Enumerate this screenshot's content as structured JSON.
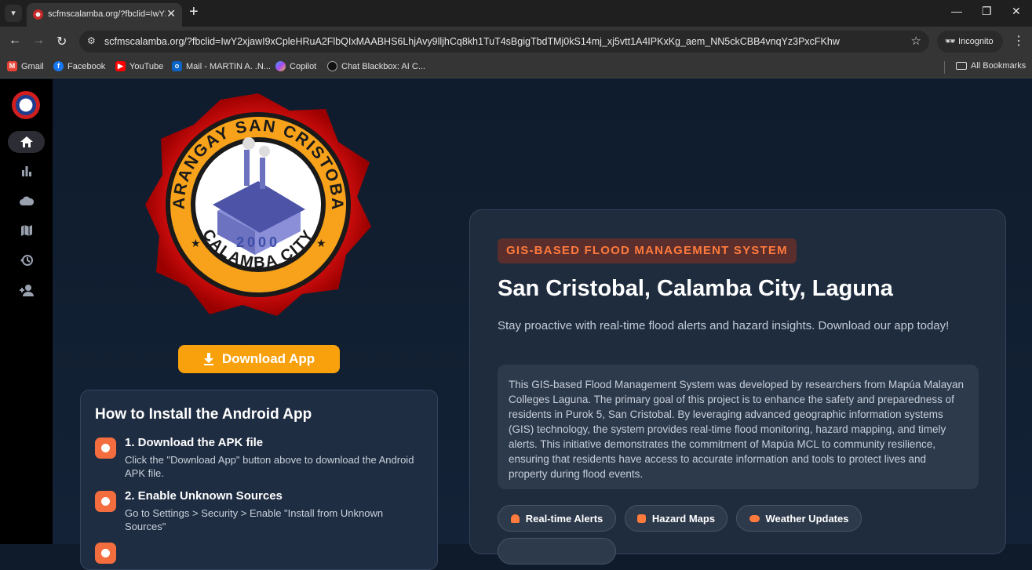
{
  "browser": {
    "tab_title": "scfmscalamba.org/?fbclid=IwY2",
    "url": "scfmscalamba.org/?fbclid=IwY2xjawI9xCpleHRuA2FlbQIxMAABHS6LhjAvy9lljhCq8kh1TuT4sBgigTbdTMj0kS14mj_xj5vtt1A4IPKxKg_aem_NN5ckCBB4vnqYz3PxcFKhw",
    "incognito_label": "Incognito",
    "bookmarks": [
      {
        "label": "Gmail",
        "icon": "gmail-icon",
        "color": "#ea4335"
      },
      {
        "label": "Facebook",
        "icon": "facebook-icon",
        "color": "#1877f2"
      },
      {
        "label": "YouTube",
        "icon": "youtube-icon",
        "color": "#ff0000"
      },
      {
        "label": "Mail - MARTIN A. .N...",
        "icon": "outlook-icon",
        "color": "#0a64c8"
      },
      {
        "label": "Copilot",
        "icon": "copilot-icon",
        "color": "#8a5cf0"
      },
      {
        "label": "Chat Blackbox: AI C...",
        "icon": "blackbox-icon",
        "color": "#222222"
      }
    ],
    "all_bookmarks_label": "All Bookmarks"
  },
  "sidebar": {
    "items": [
      {
        "name": "home",
        "icon": "home-icon",
        "active": true
      },
      {
        "name": "stats",
        "icon": "bar-chart-icon"
      },
      {
        "name": "weather",
        "icon": "cloud-icon"
      },
      {
        "name": "map",
        "icon": "map-icon"
      },
      {
        "name": "history",
        "icon": "history-icon"
      },
      {
        "name": "add-user",
        "icon": "person-add-icon"
      }
    ]
  },
  "logo": {
    "top_text": "BARANGAY SAN CRISTOBAL",
    "bottom_text": "CALAMBA CITY",
    "year": "2000"
  },
  "download_button": "Download App",
  "install": {
    "title": "How to Install the Android App",
    "steps": [
      {
        "title": "1. Download the APK file",
        "desc": "Click the \"Download App\" button above to download the Android APK file."
      },
      {
        "title": "2. Enable Unknown Sources",
        "desc": "Go to Settings > Security > Enable \"Install from Unknown Sources\""
      }
    ]
  },
  "hero": {
    "tag": "GIS-BASED FLOOD MANAGEMENT SYSTEM",
    "headline": "San Cristobal, Calamba City, Laguna",
    "subtitle": "Stay proactive with real-time flood alerts and hazard insights. Download our app today!",
    "about": "This GIS-based Flood Management System was developed by researchers from Mapúa Malayan Colleges Laguna. The primary goal of this project is to enhance the safety and preparedness of residents in Purok 5, San Cristobal. By leveraging advanced geographic information systems (GIS) technology, the system provides real-time flood monitoring, hazard mapping, and timely alerts. This initiative demonstrates the commitment of Mapúa MCL to community resilience, ensuring that residents have access to accurate information and tools to protect lives and property during flood events.",
    "features": [
      "Real-time Alerts",
      "Hazard Maps",
      "Weather Updates"
    ]
  },
  "colors": {
    "accent_orange": "#f8a10c",
    "tag_orange": "#ff7a3d",
    "step_icon": "#f36d3e"
  }
}
